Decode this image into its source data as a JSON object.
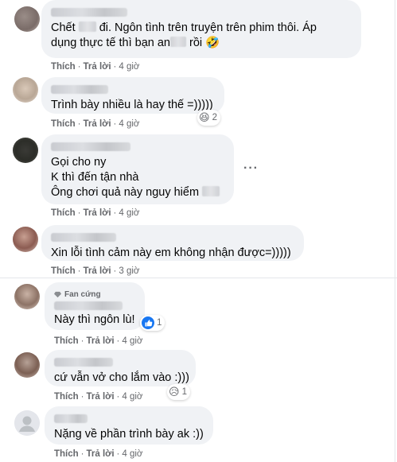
{
  "actions": {
    "like": "Thích",
    "reply": "Trả lời",
    "sep": "·"
  },
  "comments": [
    {
      "id": "c1",
      "line1_pre": "Chết ",
      "line1_post": " đi. Ngôn tình trên truyện trên phim thôi. Áp",
      "line2_pre": "dụng thực tế thì bạn an",
      "line2_post": " rồi 🤣",
      "time": "4 giờ"
    },
    {
      "id": "c2",
      "line1": "Trình bày nhiều là hay thế =)))))",
      "time": "4 giờ",
      "reaction_emoji": "😆",
      "reaction_count": "2"
    },
    {
      "id": "c3",
      "line1": "Gọi cho ny",
      "line2": "K thì đến tận nhà",
      "line3": "Ông chơi quả này nguy hiểm",
      "time": "4 giờ",
      "more": "···"
    },
    {
      "id": "c4",
      "line1": "Xin lỗi tình cảm này em không nhận được=)))))",
      "time": "3 giờ"
    },
    {
      "id": "c5",
      "badge": "Fan cứng",
      "line1": "Này thì ngôn lù!",
      "time": "4 giờ",
      "reaction_count": "1"
    },
    {
      "id": "c6",
      "line1": "cứ vẫn vở cho lắm vào :)))",
      "time": "4 giờ",
      "reaction_emoji": "😥",
      "reaction_count": "1"
    },
    {
      "id": "c7",
      "line1": "Nặng về phần trình bày ak :))",
      "time": "4 giờ"
    }
  ],
  "colors": {
    "bubble": "#f0f2f5",
    "meta": "#65676b",
    "like_blue": "#1877f2"
  }
}
